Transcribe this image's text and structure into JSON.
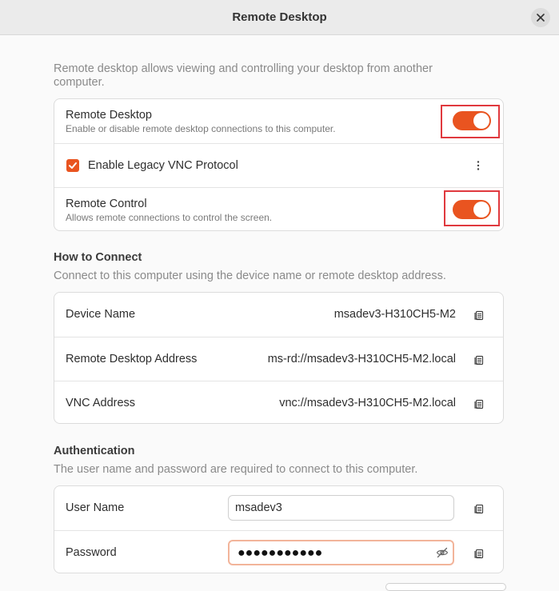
{
  "window": {
    "title": "Remote Desktop"
  },
  "intro": "Remote desktop allows viewing and controlling your desktop from another computer.",
  "toggles": {
    "remote_desktop": {
      "title": "Remote Desktop",
      "subtitle": "Enable or disable remote desktop connections to this computer.",
      "on": true
    },
    "legacy_vnc": {
      "label": "Enable Legacy VNC Protocol",
      "checked": true
    },
    "remote_control": {
      "title": "Remote Control",
      "subtitle": "Allows remote connections to control the screen.",
      "on": true
    }
  },
  "how_to_connect": {
    "title": "How to Connect",
    "description": "Connect to this computer using the device name or remote desktop address.",
    "rows": [
      {
        "label": "Device Name",
        "value": "msadev3-H310CH5-M2"
      },
      {
        "label": "Remote Desktop Address",
        "value": "ms-rd://msadev3-H310CH5-M2.local"
      },
      {
        "label": "VNC Address",
        "value": "vnc://msadev3-H310CH5-M2.local"
      }
    ]
  },
  "authentication": {
    "title": "Authentication",
    "description": "The user name and password are required to connect to this computer.",
    "user_name_label": "User Name",
    "user_name_value": "msadev3",
    "password_label": "Password",
    "password_mask": "●●●●●●●●●●●"
  },
  "colors": {
    "accent": "#e95420",
    "highlight": "#e0393e"
  },
  "icons": {
    "close": "close-icon",
    "copy": "copy-icon",
    "checkmark": "checkmark-icon",
    "kebab": "vertical-ellipsis-icon",
    "eye": "eye-slash-icon"
  }
}
